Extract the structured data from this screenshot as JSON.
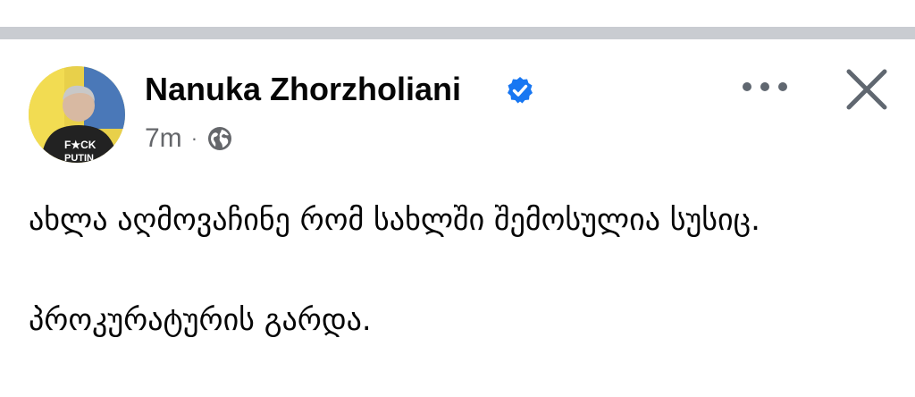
{
  "post": {
    "author": "Nanuka Zhorzholiani",
    "verified": true,
    "timestamp": "7m",
    "separator": "·",
    "audience_icon": "globe-icon",
    "actions": {
      "more_icon": "more-dots-icon",
      "close_icon": "close-icon"
    },
    "avatar_shirt_text_line1": "F★CK",
    "avatar_shirt_text_line2": "PUTIN",
    "text_paragraph_1": "ახლა აღმოვაჩინე რომ სახლში შემოსულია სუსიც.",
    "text_paragraph_2": "პროკურატურის გარდა."
  },
  "colors": {
    "divider": "#c9ccd1",
    "name": "#050505",
    "meta": "#65676b",
    "verified_badge": "#1877f2",
    "icon": "#606770"
  }
}
